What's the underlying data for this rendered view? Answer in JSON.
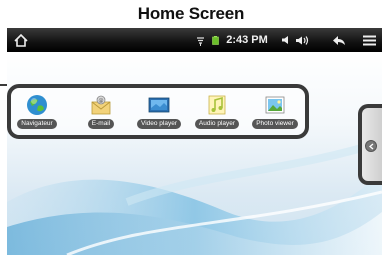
{
  "title": "Home Screen",
  "status_bar": {
    "time": "2:43 PM",
    "icons": [
      "home-icon",
      "wifi-icon",
      "battery-icon",
      "volume-down-icon",
      "volume-up-icon",
      "back-icon",
      "menu-icon"
    ]
  },
  "apps": [
    {
      "label": "Navigateur",
      "icon": "globe-icon"
    },
    {
      "label": "E-mail",
      "icon": "email-icon"
    },
    {
      "label": "Video player",
      "icon": "video-player-icon"
    },
    {
      "label": "Audio player",
      "icon": "audio-player-icon"
    },
    {
      "label": "Photo viewer",
      "icon": "photo-viewer-icon"
    }
  ],
  "colors": {
    "status_bar": "#111111",
    "battery": "#6bbf2a",
    "outline": "#3a3a3a",
    "wallpaper_accent": "#a9d3ea"
  }
}
